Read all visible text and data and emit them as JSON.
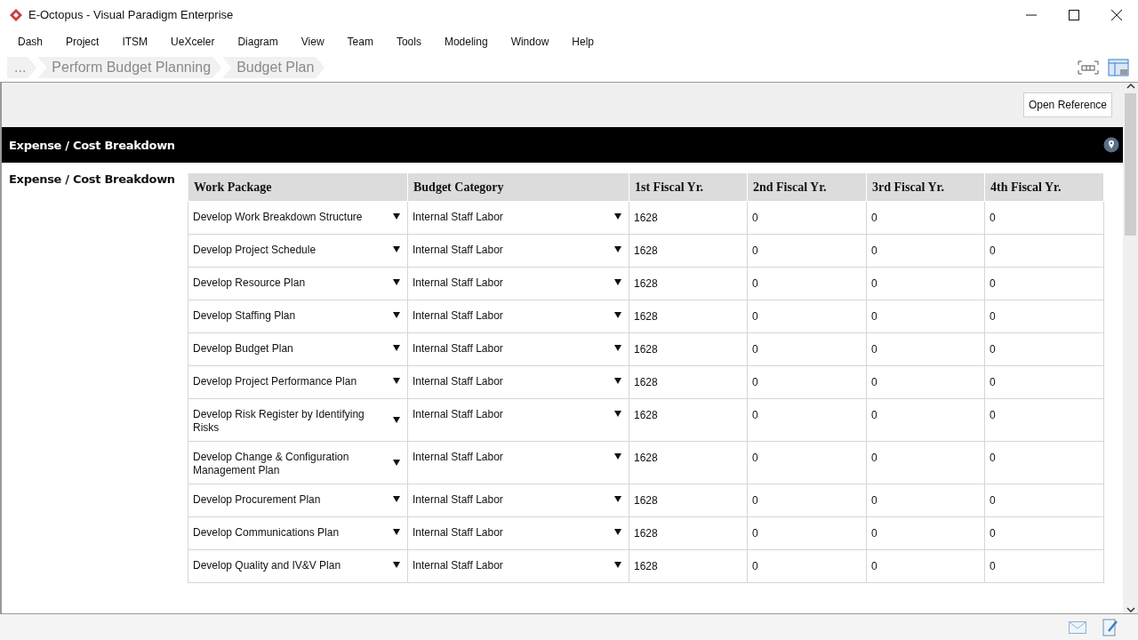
{
  "window": {
    "title": "E-Octopus - Visual Paradigm Enterprise"
  },
  "menu": [
    "Dash",
    "Project",
    "ITSM",
    "UeXceler",
    "Diagram",
    "View",
    "Team",
    "Tools",
    "Modeling",
    "Window",
    "Help"
  ],
  "breadcrumb": [
    "...",
    "Perform Budget Planning",
    "Budget Plan"
  ],
  "toolbar": {
    "button": "Open Reference"
  },
  "section": {
    "title": "Expense / Cost Breakdown",
    "label": "Expense / Cost Breakdown"
  },
  "table": {
    "columns": [
      "Work Package",
      "Budget Category",
      "1st Fiscal Yr.",
      "2nd Fiscal Yr.",
      "3rd Fiscal Yr.",
      "4th Fiscal Yr."
    ],
    "rows": [
      [
        "Develop Work Breakdown Structure",
        "Internal Staff Labor",
        "1628",
        "0",
        "0",
        "0"
      ],
      [
        "Develop Project Schedule",
        "Internal Staff Labor",
        "1628",
        "0",
        "0",
        "0"
      ],
      [
        "Develop Resource Plan",
        "Internal Staff Labor",
        "1628",
        "0",
        "0",
        "0"
      ],
      [
        "Develop Staffing Plan",
        "Internal Staff Labor",
        "1628",
        "0",
        "0",
        "0"
      ],
      [
        "Develop Budget Plan",
        "Internal Staff Labor",
        "1628",
        "0",
        "0",
        "0"
      ],
      [
        "Develop Project Performance Plan",
        "Internal Staff Labor",
        "1628",
        "0",
        "0",
        "0"
      ],
      [
        "Develop Risk Register by Identifying Risks",
        "Internal Staff Labor",
        "1628",
        "0",
        "0",
        "0"
      ],
      [
        "Develop Change & Configuration Management Plan",
        "Internal Staff Labor",
        "1628",
        "0",
        "0",
        "0"
      ],
      [
        "Develop Procurement Plan",
        "Internal Staff Labor",
        "1628",
        "0",
        "0",
        "0"
      ],
      [
        "Develop Communications Plan",
        "Internal Staff Labor",
        "1628",
        "0",
        "0",
        "0"
      ],
      [
        "Develop Quality and IV&V Plan",
        "Internal Staff Labor",
        "1628",
        "0",
        "0",
        "0"
      ]
    ]
  }
}
